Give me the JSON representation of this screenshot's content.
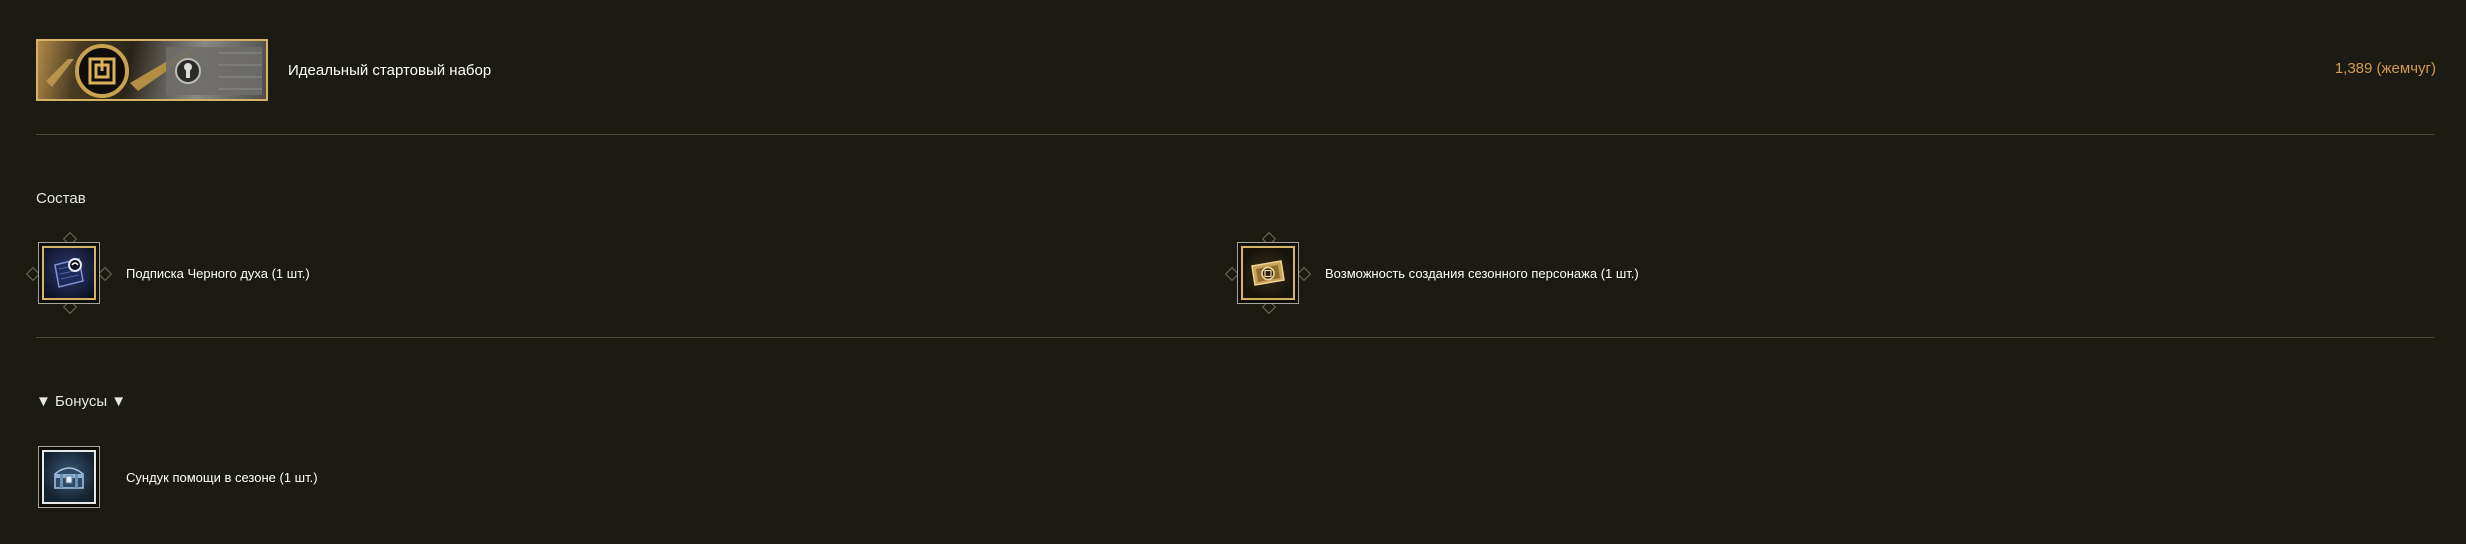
{
  "product": {
    "image_icon": "starter-pack-banner",
    "title": "Идеальный стартовый набор",
    "price": "1,389 (жемчуг)"
  },
  "composition": {
    "title": "Состав",
    "items": [
      {
        "icon": "black-spirit-subscription-icon",
        "label": "Подписка Черного духа (1 шт.)"
      },
      {
        "icon": "season-character-ticket-icon",
        "label": "Возможность создания сезонного персонажа (1 шт.)"
      }
    ]
  },
  "bonuses": {
    "title": "▼ Бонусы ▼",
    "items": [
      {
        "icon": "season-support-chest-icon",
        "label": "Сундук помощи в сезоне (1 шт.)"
      }
    ]
  },
  "colors": {
    "background": "#1b1a13",
    "price": "#d49c4e",
    "gold_border": "#d6b264",
    "divider": "#4a4939"
  }
}
